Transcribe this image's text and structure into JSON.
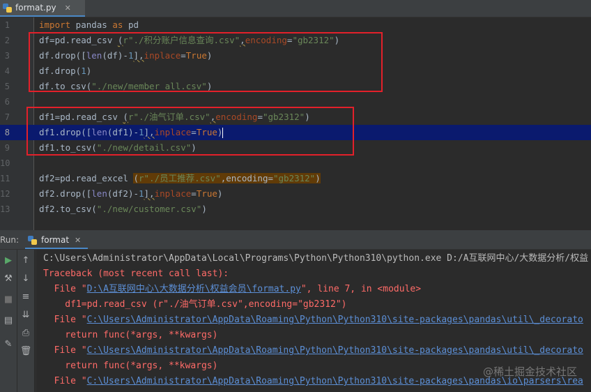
{
  "editor_tab": {
    "filename": "format.py",
    "close": "✕"
  },
  "code_lines": [
    {
      "n": "1"
    },
    {
      "n": "2"
    },
    {
      "n": "3"
    },
    {
      "n": "4"
    },
    {
      "n": "5"
    },
    {
      "n": "6"
    },
    {
      "n": "7"
    },
    {
      "n": "8"
    },
    {
      "n": "9"
    },
    {
      "n": "10"
    },
    {
      "n": "11"
    },
    {
      "n": "12"
    },
    {
      "n": "13"
    }
  ],
  "code": {
    "l1": {
      "kw1": "import",
      "t1": " pandas ",
      "kw2": "as",
      "t2": " pd"
    },
    "l2": {
      "t1": "df=pd.read_csv ",
      "t2": "(",
      "s1": "r\"./积分账户信息查询.csv\"",
      "t3": ",",
      "p1": "encoding",
      "t4": "=",
      "s2": "\"gb2312\"",
      "t5": ")"
    },
    "l3": {
      "t1": "df.drop([",
      "b1": "len",
      "t2": "(df)-",
      "n1": "1",
      "t3": "],",
      "p1": "inplace",
      "t4": "=",
      "k1": "True",
      "t5": ")"
    },
    "l4": {
      "t1": "df.drop(",
      "n1": "1",
      "t2": ")"
    },
    "l5": {
      "t1": "df.to_csv(",
      "s1": "\"./new/member_all.csv\"",
      "t2": ")"
    },
    "l7": {
      "t1": "df1=pd.read_csv ",
      "t2": "(",
      "s1": "r\"./油气订单.csv\"",
      "t3": ",",
      "p1": "encoding",
      "t4": "=",
      "s2": "\"gb2312\"",
      "t5": ")"
    },
    "l8": {
      "t1": "df1.drop([",
      "b1": "len",
      "t2": "(df1)-",
      "n1": "1",
      "t3": "],",
      "p1": "inplace",
      "t4": "=",
      "k1": "True",
      "t5": ")"
    },
    "l9": {
      "t1": "df1.to_csv(",
      "s1": "\"./new/detail.csv\"",
      "t2": ")"
    },
    "l11": {
      "t1": "df2=pd.read_excel ",
      "t2": "(",
      "s1": "r\"./员工推荐.csv\"",
      "t3": ",encoding=",
      "s2": "\"gb2312\"",
      "t4": ")"
    },
    "l12": {
      "t1": "df2.drop([",
      "b1": "len",
      "t2": "(df2)-",
      "n1": "1",
      "t3": "],",
      "p1": "inplace",
      "t4": "=",
      "k1": "True",
      "t5": ")"
    },
    "l13": {
      "t1": "df2.to_csv(",
      "s1": "\"./new/customer.csv\"",
      "t2": ")"
    }
  },
  "run_panel": {
    "label": "Run:",
    "tab": "format",
    "close": "✕"
  },
  "console": {
    "c1": "C:\\Users\\Administrator\\AppData\\Local\\Programs\\Python\\Python310\\python.exe D:/A互联网中心/大数据分析/权益",
    "c2": "Traceback (most recent call last):",
    "c3": {
      "a": "  File \"",
      "link": "D:\\A互联网中心\\大数据分析\\权益会员\\format.py",
      "b": "\", line 7, in <module>"
    },
    "c4": "    df1=pd.read_csv (r\"./油气订单.csv\",encoding=\"gb2312\")",
    "c5": {
      "a": "  File \"",
      "link": "C:\\Users\\Administrator\\AppData\\Roaming\\Python\\Python310\\site-packages\\pandas\\util\\_decorato"
    },
    "c6": "    return func(*args, **kwargs)",
    "c7": {
      "a": "  File \"",
      "link": "C:\\Users\\Administrator\\AppData\\Roaming\\Python\\Python310\\site-packages\\pandas\\util\\_decorato"
    },
    "c8": "    return func(*args, **kwargs)",
    "c9": {
      "a": "  File \"",
      "link": "C:\\Users\\Administrator\\AppData\\Roaming\\Python\\Python310\\site-packages\\pandas\\io\\parsers\\rea"
    }
  },
  "watermark": "@稀土掘金技术社区",
  "colors": {
    "keyword": "#cc7832",
    "string": "#6a8759",
    "number": "#6897bb",
    "error": "#ff6b68",
    "link": "#5c8fd6",
    "highlight_box": "#e3202a"
  }
}
